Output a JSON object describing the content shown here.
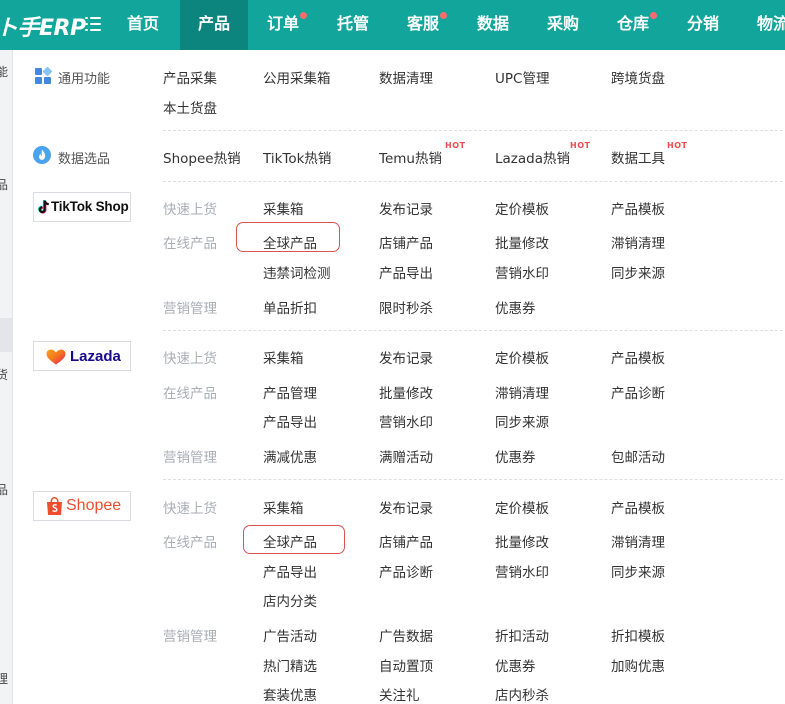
{
  "app": {
    "logo_text": "ト手ERP"
  },
  "nav": {
    "items": [
      "首页",
      "产品",
      "订单",
      "托管",
      "客服",
      "数据",
      "采购",
      "仓库",
      "分销",
      "物流"
    ],
    "active": "产品"
  },
  "left_strip": [
    "能",
    "品",
    "货",
    "品",
    "理"
  ],
  "sections": {
    "common": {
      "title": "通用功能",
      "links": [
        "产品采集",
        "公用采集箱",
        "数据清理",
        "UPC管理",
        "跨境货盘",
        "本土货盘"
      ]
    },
    "data_select": {
      "title": "数据选品",
      "links": [
        "Shopee热销",
        "TikTok热销",
        "Temu热销",
        "Lazada热销",
        "数据工具"
      ],
      "hot_badge": "HOT"
    },
    "tiktok": {
      "brand": "TikTok Shop",
      "groups": {
        "quick": {
          "label": "快速上货",
          "links": [
            "采集箱",
            "发布记录",
            "定价模板",
            "产品模板"
          ]
        },
        "online": {
          "label": "在线产品",
          "links": [
            "全球产品",
            "店铺产品",
            "批量修改",
            "滞销清理",
            "违禁词检测",
            "产品导出",
            "营销水印",
            "同步来源"
          ]
        },
        "marketing": {
          "label": "营销管理",
          "links": [
            "单品折扣",
            "限时秒杀",
            "优惠券"
          ]
        }
      }
    },
    "lazada": {
      "brand": "Lazada",
      "groups": {
        "quick": {
          "label": "快速上货",
          "links": [
            "采集箱",
            "发布记录",
            "定价模板",
            "产品模板"
          ]
        },
        "online": {
          "label": "在线产品",
          "links": [
            "产品管理",
            "批量修改",
            "滞销清理",
            "产品诊断",
            "产品导出",
            "营销水印",
            "同步来源"
          ]
        },
        "marketing": {
          "label": "营销管理",
          "links": [
            "满减优惠",
            "满赠活动",
            "优惠券",
            "包邮活动"
          ]
        }
      }
    },
    "shopee": {
      "brand": "Shopee",
      "groups": {
        "quick": {
          "label": "快速上货",
          "links": [
            "采集箱",
            "发布记录",
            "定价模板",
            "产品模板"
          ]
        },
        "online": {
          "label": "在线产品",
          "links": [
            "全球产品",
            "店铺产品",
            "批量修改",
            "滞销清理",
            "产品导出",
            "产品诊断",
            "营销水印",
            "同步来源",
            "店内分类"
          ]
        },
        "marketing": {
          "label": "营销管理",
          "links": [
            "广告活动",
            "广告数据",
            "折扣活动",
            "折扣模板",
            "热门精选",
            "自动置顶",
            "优惠券",
            "加购优惠",
            "套装优惠",
            "关注礼",
            "店内秒杀"
          ]
        }
      }
    }
  },
  "colors": {
    "nav_bg": "#11a59c",
    "nav_active_bg": "#0c857f",
    "notify_dot": "#ff6b6b",
    "hot_badge": "#ef4d4d",
    "highlight_circle": "#d9534f",
    "group_label": "#a9aeb6",
    "tiktok_pink": "#ee1d52",
    "tiktok_cyan": "#25f4ee",
    "lazada_orange": "#f5731b",
    "lazada_purple": "#1a0b8c",
    "shopee_orange": "#ee4d2d"
  },
  "icons": {
    "menu_toggle": "menu-toggle-icon",
    "common": "grid-icon",
    "data_select": "flame-icon",
    "tiktok_logo": "tiktok-note-icon",
    "lazada_logo": "lazada-heart-icon",
    "shopee_logo": "shopping-bag-icon"
  }
}
